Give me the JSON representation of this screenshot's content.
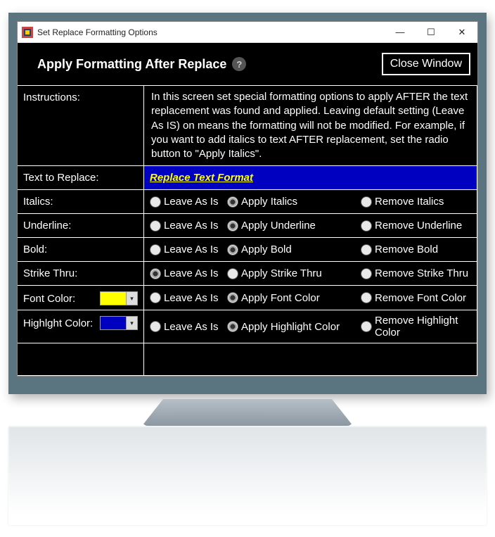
{
  "window": {
    "title": "Set Replace Formatting Options",
    "controls": {
      "minimize": "—",
      "maximize": "☐",
      "close": "✕"
    }
  },
  "header": {
    "title": "Apply Formatting After Replace",
    "help": "?",
    "close_btn": "Close Window"
  },
  "labels": {
    "instructions": "Instructions:",
    "text_to_replace": "Text to Replace:",
    "italics": "Italics:",
    "underline": "Underline:",
    "bold": "Bold:",
    "strike": "Strike Thru:",
    "font_color": "Font Color:",
    "highlight_color": "Highlght Color:"
  },
  "instructions_text": "In this screen set special formatting options to apply AFTER the text replacement was found and applied. Leaving default setting (Leave As IS) on means the formatting will not be modified. For example, if you want to add italics to text AFTER replacement, set the radio button to \"Apply Italics\".",
  "replace_text": "Replace Text Format",
  "options": {
    "leave": "Leave As Is",
    "italics": {
      "apply": "Apply Italics",
      "remove": "Remove Italics",
      "selected": 0
    },
    "underline": {
      "apply": "Apply Underline",
      "remove": "Remove Underline",
      "selected": 0
    },
    "bold": {
      "apply": "Apply Bold",
      "remove": "Remove Bold",
      "selected": 0
    },
    "strike": {
      "apply": "Apply Strike Thru",
      "remove": "Remove Strike Thru",
      "selected": 0
    },
    "font_color": {
      "apply": "Apply Font Color",
      "remove": "Remove Font Color",
      "selected": 0
    },
    "highlight_color": {
      "apply": "Apply Highlight Color",
      "remove": "Remove Highlight Color",
      "selected": 0
    }
  },
  "colors": {
    "font_color_swatch": "#ffff00",
    "highlight_color_swatch": "#0000c0"
  }
}
